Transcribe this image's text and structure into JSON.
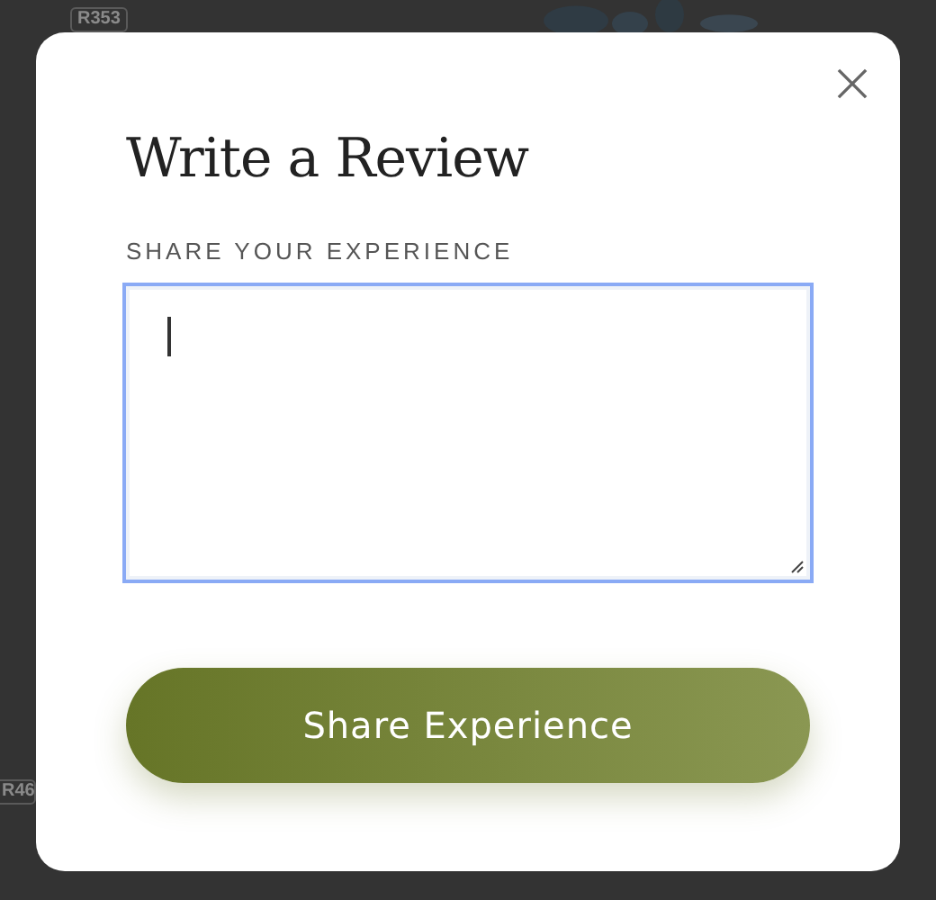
{
  "background": {
    "badges": [
      "R353",
      "R46"
    ]
  },
  "dialog": {
    "title": "Write a Review",
    "field": {
      "label": "SHARE YOUR EXPERIENCE",
      "focused": true
    },
    "submit_button": "Share Experience"
  }
}
